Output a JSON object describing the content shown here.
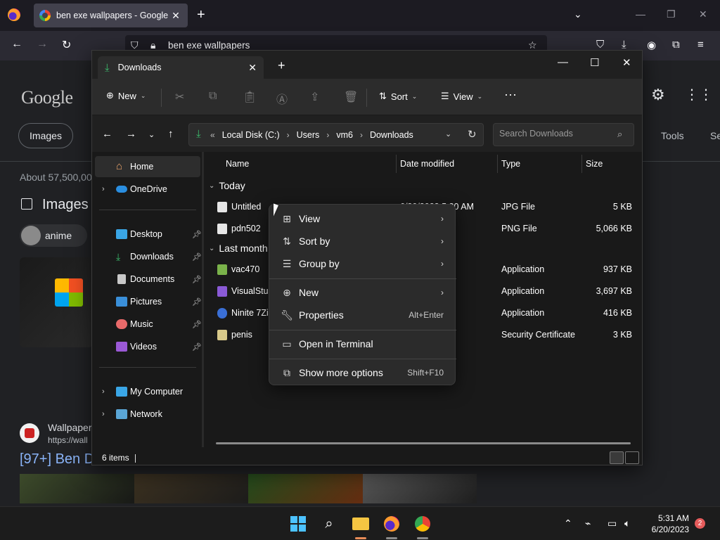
{
  "browser": {
    "tab_title": "ben exe wallpapers - Google Se",
    "url": "ben exe wallpapers"
  },
  "google": {
    "logo": "Google",
    "chip_images": "Images",
    "tools": "Tools",
    "se": "Se",
    "about": "About 57,500,00",
    "images_heading": "Images",
    "anime_chip": "anime",
    "wallpaper_site": "Wallpaper",
    "wallpaper_url": "https://wall",
    "result_link": "[97+] Ben D"
  },
  "explorer": {
    "tab_title": "Downloads",
    "toolbar": {
      "new_label": "New",
      "sort_label": "Sort",
      "view_label": "View"
    },
    "breadcrumb": [
      "Local Disk (C:)",
      "Users",
      "vm6",
      "Downloads"
    ],
    "search_placeholder": "Search Downloads",
    "nav": {
      "home": "Home",
      "onedrive": "OneDrive",
      "desktop": "Desktop",
      "downloads": "Downloads",
      "documents": "Documents",
      "pictures": "Pictures",
      "music": "Music",
      "videos": "Videos",
      "mycomputer": "My Computer",
      "network": "Network"
    },
    "columns": {
      "name": "Name",
      "date": "Date modified",
      "type": "Type",
      "size": "Size"
    },
    "groups": {
      "today": "Today",
      "last_month": "Last month"
    },
    "files": [
      {
        "name": "Untitled",
        "date": "6/20/2023 5:30 AM",
        "type": "JPG File",
        "size": "5 KB"
      },
      {
        "name": "pdn502",
        "date": "AM",
        "type": "PNG File",
        "size": "5,066 KB"
      },
      {
        "name": "vac470",
        "date": "PM",
        "type": "Application",
        "size": "937 KB"
      },
      {
        "name": "VisualStuc",
        "date": "PM",
        "type": "Application",
        "size": "3,697 KB"
      },
      {
        "name": "Ninite 7Zip",
        "date": "PM",
        "type": "Application",
        "size": "416 KB"
      },
      {
        "name": "penis",
        "date": "PM",
        "type": "Security Certificate",
        "size": "3 KB"
      }
    ],
    "status": "6 items"
  },
  "context_menu": {
    "view": "View",
    "sort_by": "Sort by",
    "group_by": "Group by",
    "new": "New",
    "properties": "Properties",
    "properties_shortcut": "Alt+Enter",
    "open_terminal": "Open in Terminal",
    "show_more": "Show more options",
    "show_more_shortcut": "Shift+F10"
  },
  "taskbar": {
    "time": "5:31 AM",
    "date": "6/20/2023",
    "notifications": "2"
  }
}
